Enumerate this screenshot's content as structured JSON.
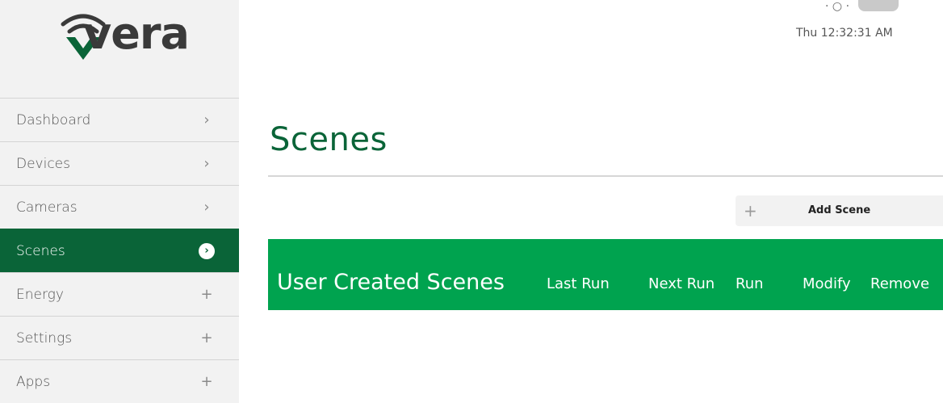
{
  "brand": {
    "name": "vera",
    "trademark": "™",
    "color": "#0a6438"
  },
  "sidebar": {
    "items": [
      {
        "label": "Dashboard",
        "indicator": "›",
        "active": false
      },
      {
        "label": "Devices",
        "indicator": "›",
        "active": false
      },
      {
        "label": "Cameras",
        "indicator": "›",
        "active": false
      },
      {
        "label": "Scenes",
        "indicator": "›",
        "active": true
      },
      {
        "label": "Energy",
        "indicator": "+",
        "active": false
      },
      {
        "label": "Settings",
        "indicator": "+",
        "active": false
      },
      {
        "label": "Apps",
        "indicator": "+",
        "active": false
      }
    ]
  },
  "header": {
    "clock": "Thu  12:32:31 AM",
    "partial_top": "· ○ ·"
  },
  "main": {
    "title": "Scenes",
    "add_scene": {
      "icon": "plus-icon",
      "label": "Add Scene"
    },
    "table_header": {
      "title": "User Created Scenes",
      "columns": [
        "Last Run",
        "Next Run",
        "Run",
        "Modify",
        "Remove"
      ]
    }
  },
  "colors": {
    "active_nav": "#0a6438",
    "header_bar": "#00a34f",
    "title": "#0a6438"
  }
}
